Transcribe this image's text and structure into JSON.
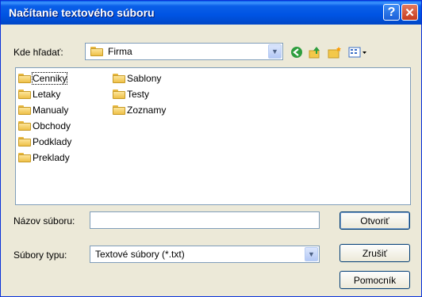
{
  "window": {
    "title": "Načítanie textového súboru"
  },
  "lookin": {
    "label": "Kde hľadať:",
    "value": "Firma"
  },
  "files": [
    {
      "name": "Cenniky",
      "selected": true
    },
    {
      "name": "Letaky"
    },
    {
      "name": "Manualy"
    },
    {
      "name": "Obchody"
    },
    {
      "name": "Podklady"
    },
    {
      "name": "Preklady"
    },
    {
      "name": "Sablony"
    },
    {
      "name": "Testy"
    },
    {
      "name": "Zoznamy"
    }
  ],
  "filename": {
    "label": "Názov súboru:",
    "value": ""
  },
  "filetype": {
    "label": "Súbory typu:",
    "value": "Textové súbory (*.txt)"
  },
  "buttons": {
    "open": "Otvoriť",
    "cancel": "Zrušiť",
    "help": "Pomocník"
  },
  "icons": [
    "help-icon",
    "close-icon",
    "folder-icon",
    "back-icon",
    "up-folder-icon",
    "new-folder-icon",
    "view-menu-icon"
  ]
}
